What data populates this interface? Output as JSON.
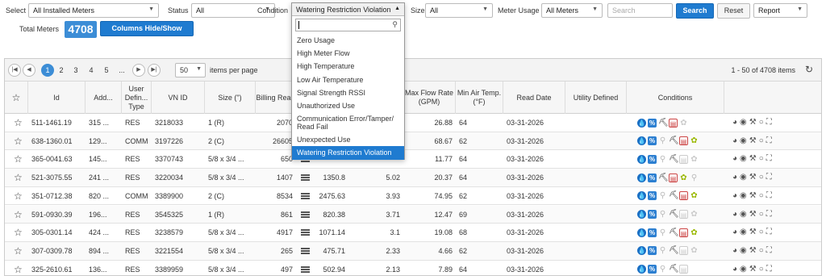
{
  "filters": {
    "select_label": "Select",
    "select_value": "All Installed Meters",
    "status_label": "Status",
    "status_value": "All",
    "condition_label": "Condition",
    "size_label": "Size",
    "size_value": "All",
    "usage_label": "Meter Usage",
    "usage_value": "All Meters",
    "search_placeholder": "Search",
    "search_button": "Search",
    "reset_button": "Reset",
    "report_value": "Report"
  },
  "summary": {
    "total_label": "Total Meters",
    "total_value": "4708",
    "columns_button": "Columns Hide/Show"
  },
  "pager": {
    "pages": [
      "1",
      "2",
      "3",
      "4",
      "5",
      "..."
    ],
    "active_page": "1",
    "page_size": "50",
    "per_page_label": "items per page",
    "items_info": "1 - 50 of 4708 items"
  },
  "columns": [
    "Id",
    "Add...",
    "User Defin... Type",
    "VN ID",
    "Size (\")",
    "Billing Read",
    "",
    "",
    "Max Flow Rate (GPM)",
    "Min Air Temp. (°F)",
    "Read Date",
    "Utility Defined",
    "Conditions",
    ""
  ],
  "rows": [
    {
      "id": "511-1461.19",
      "addr": "315 ...",
      "type": "RES",
      "vnid": "3218033",
      "size": "1 (R)",
      "billing": "2070",
      "c1": "",
      "c2": "",
      "maxflow": "26.88",
      "minair": "64",
      "date": "03-31-2026"
    },
    {
      "id": "638-1360.01",
      "addr": "129...",
      "type": "COMM",
      "vnid": "3197226",
      "size": "2 (C)",
      "billing": "26605",
      "c1": "",
      "c2": "",
      "maxflow": "68.67",
      "minair": "62",
      "date": "03-31-2026"
    },
    {
      "id": "365-0041.63",
      "addr": "145...",
      "type": "RES",
      "vnid": "3370743",
      "size": "5/8 x 3/4 ...",
      "billing": "650",
      "c1": "",
      "c2": "",
      "maxflow": "11.77",
      "minair": "64",
      "date": "03-31-2026"
    },
    {
      "id": "521-3075.55",
      "addr": "241 ...",
      "type": "RES",
      "vnid": "3220034",
      "size": "5/8 x 3/4 ...",
      "billing": "1407",
      "c1": "1350.8",
      "c2": "5.02",
      "maxflow": "20.37",
      "minair": "64",
      "date": "03-31-2026"
    },
    {
      "id": "351-0712.38",
      "addr": "820 ...",
      "type": "COMM",
      "vnid": "3389900",
      "size": "2 (C)",
      "billing": "8534",
      "c1": "2475.63",
      "c2": "3.93",
      "maxflow": "74.95",
      "minair": "62",
      "date": "03-31-2026"
    },
    {
      "id": "591-0930.39",
      "addr": "196...",
      "type": "RES",
      "vnid": "3545325",
      "size": "1 (R)",
      "billing": "861",
      "c1": "820.38",
      "c2": "3.71",
      "maxflow": "12.47",
      "minair": "69",
      "date": "03-31-2026"
    },
    {
      "id": "305-0301.14",
      "addr": "424 ...",
      "type": "RES",
      "vnid": "3238579",
      "size": "5/8 x 3/4 ...",
      "billing": "4917",
      "c1": "1071.14",
      "c2": "3.1",
      "maxflow": "19.08",
      "minair": "68",
      "date": "03-31-2026"
    },
    {
      "id": "307-0309.78",
      "addr": "894 ...",
      "type": "RES",
      "vnid": "3221554",
      "size": "5/8 x 3/4 ...",
      "billing": "265",
      "c1": "475.71",
      "c2": "2.33",
      "maxflow": "4.66",
      "minair": "62",
      "date": "03-31-2026"
    },
    {
      "id": "325-2610.61",
      "addr": "136...",
      "type": "RES",
      "vnid": "3389959",
      "size": "5/8 x 3/4 ...",
      "billing": "497",
      "c1": "502.94",
      "c2": "2.13",
      "maxflow": "7.89",
      "minair": "64",
      "date": "03-31-2026"
    }
  ],
  "condition_dropdown": {
    "current": "Watering Restriction Violation",
    "items": [
      "Zero Usage",
      "High Meter Flow",
      "High Temperature",
      "Low Air Temperature",
      "Signal Strength RSSI",
      "Unauthorized Use",
      "Communication Error/Tamper/ Read Fail",
      "Unexpected Use",
      "Watering Restriction Violation"
    ]
  },
  "icons": {
    "condition": [
      "water-drop-icon",
      "percent-icon",
      "tap-icon",
      "faucet-icon",
      "flag-icon",
      "plant-icon"
    ],
    "actions": [
      "dashboard-icon",
      "eye-icon",
      "wrench-icon",
      "circle-icon",
      "expand-icon"
    ]
  },
  "colors": {
    "accent": "#1f7bd0",
    "selected": "#1f7bd0"
  }
}
